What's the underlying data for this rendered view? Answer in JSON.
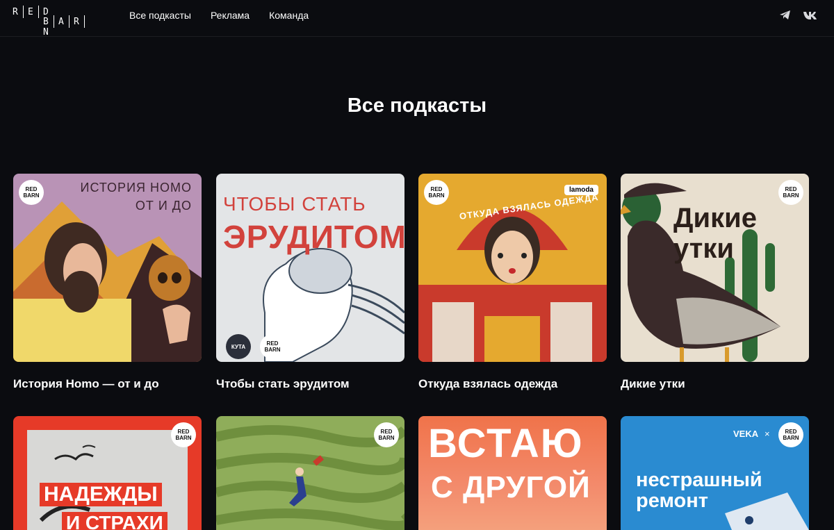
{
  "header": {
    "logo_top": "RED",
    "logo_bottom": "BARN",
    "nav": [
      "Все подкасты",
      "Реклама",
      "Команда"
    ],
    "social": [
      "telegram-icon",
      "vk-icon"
    ]
  },
  "page_title": "Все подкасты",
  "podcasts": [
    {
      "title": "История Homo — от и до",
      "cover_line1": "ИСТОРИЯ HOMO",
      "cover_line2": "ОТ И ДО",
      "badge": "RED BARN"
    },
    {
      "title": "Чтобы стать эрудитом",
      "cover_line1": "ЧТОБЫ СТАТЬ",
      "cover_line2": "ЭРУДИТОМ",
      "partner": "КУТА",
      "badge": "RED BARN"
    },
    {
      "title": "Откуда взялась одежда",
      "cover_arc": "ОТКУДА ВЗЯЛАСЬ ОДЕЖДА",
      "partner": "lamoda",
      "badge": "RED BARN"
    },
    {
      "title": "Дикие утки",
      "cover_line1": "Дикие",
      "cover_line2": "утки",
      "badge": "RED BARN"
    },
    {
      "title": "",
      "cover_line1": "НАДЕЖДЫ",
      "cover_line2": "И СТРАХИ",
      "badge": "RED BARN"
    },
    {
      "title": "",
      "badge": "RED BARN"
    },
    {
      "title": "",
      "cover_line1": "ВСТАЮ",
      "cover_line2": "С ДРУГОЙ",
      "badge": ""
    },
    {
      "title": "",
      "cover_line1": "нестрашный",
      "cover_line2": "ремонт",
      "partner": "VEKA",
      "badge": "RED BARN"
    }
  ],
  "colors": {
    "background": "#0b0c10",
    "text": "#ffffff"
  }
}
